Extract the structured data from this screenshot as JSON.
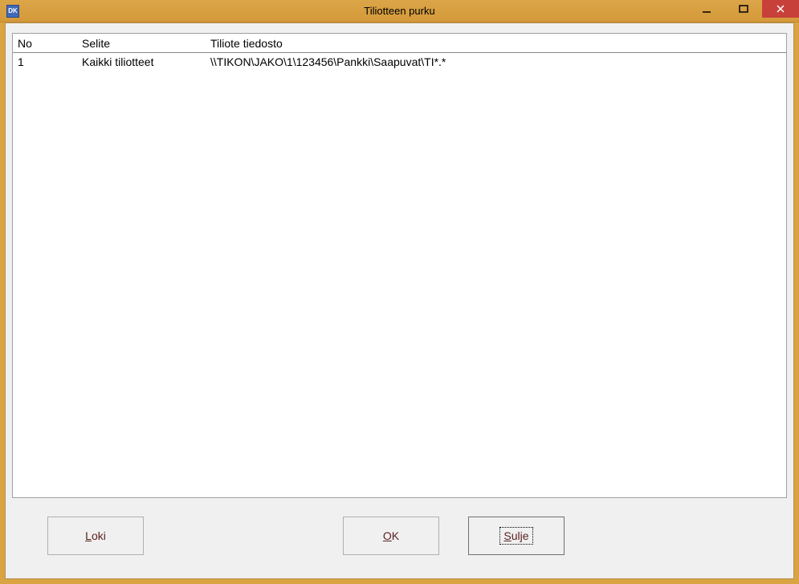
{
  "window": {
    "title": "Tiliotteen purku",
    "icon_text": "DK"
  },
  "table": {
    "headers": {
      "no": "No",
      "selite": "Selite",
      "tiedosto": "Tiliote tiedosto"
    },
    "rows": [
      {
        "no": "1",
        "selite": "Kaikki tiliotteet",
        "tiedosto": "\\\\TIKON\\JAKO\\1\\123456\\Pankki\\Saapuvat\\TI*.*"
      }
    ]
  },
  "buttons": {
    "loki": {
      "prefix": "",
      "mnemonic": "L",
      "rest": "oki"
    },
    "ok": {
      "prefix": "",
      "mnemonic": "O",
      "rest": "K"
    },
    "sulje": {
      "prefix": "",
      "mnemonic": "S",
      "rest": "ulje"
    }
  }
}
